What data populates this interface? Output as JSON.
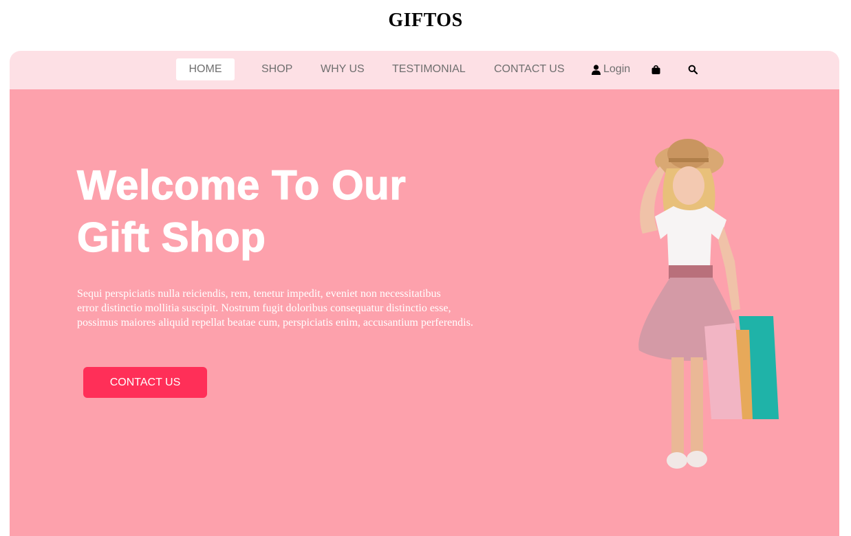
{
  "brand": {
    "name": "GIFTOS"
  },
  "nav": {
    "items": [
      {
        "label": "HOME",
        "active": true
      },
      {
        "label": "SHOP"
      },
      {
        "label": "WHY US"
      },
      {
        "label": "TESTIMONIAL"
      },
      {
        "label": "CONTACT US"
      }
    ],
    "login_label": "Login",
    "icons": [
      "user-icon",
      "shopping-bag-icon",
      "search-icon"
    ]
  },
  "hero": {
    "title_line1": "Welcome To Our",
    "title_line2": "Gift Shop",
    "text_line1": "Sequi perspiciatis nulla reiciendis, rem, tenetur impedit, eveniet non necessitatibus",
    "text_line2": "error distinctio mollitia suscipit. Nostrum fugit doloribus consequatur distinctio esse,",
    "text_line3": "possimus maiores aliquid repellat beatae cum, perspiciatis enim, accusantium perferendis.",
    "cta_label": "CONTACT US"
  },
  "colors": {
    "navbar_bg": "#fde0e5",
    "hero_bg": "#fda1ac",
    "cta_bg": "#ff2f58",
    "nav_text": "#6f6f6f"
  }
}
